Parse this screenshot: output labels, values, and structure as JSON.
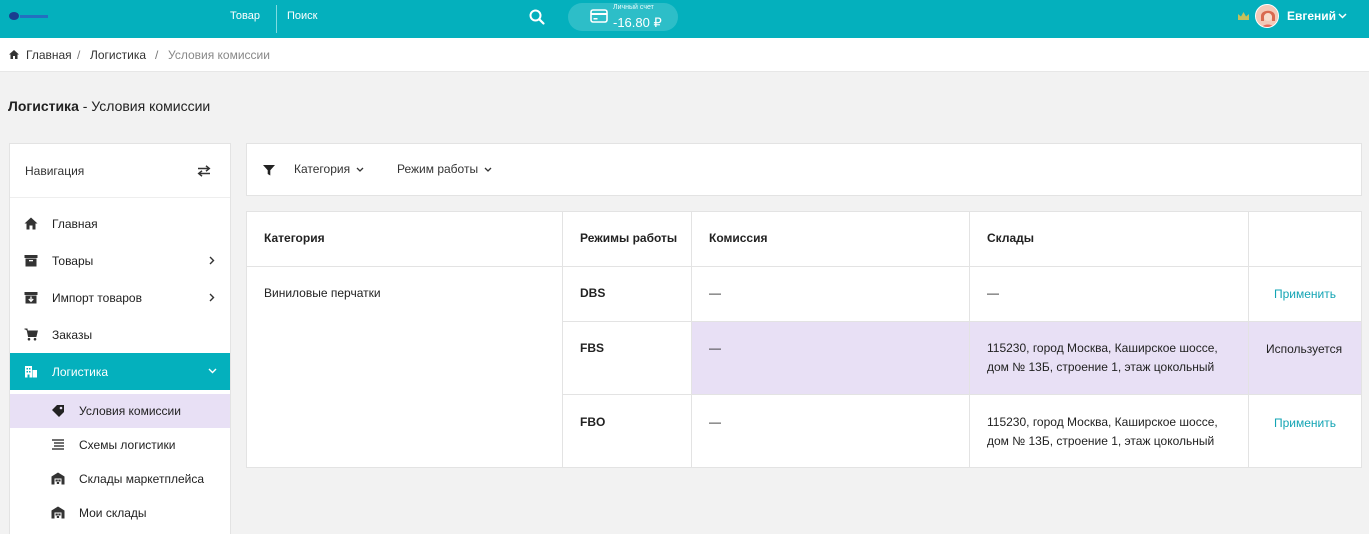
{
  "topbar": {
    "nav_tovar": "Товар",
    "nav_search": "Поиск",
    "account_label": "Личный счет",
    "account_value": "-16.80 ₽",
    "user_name": "Евгений"
  },
  "breadcrumb": {
    "home": "Главная",
    "logistics": "Логистика",
    "current": "Условия комиссии",
    "separator": "/"
  },
  "page_title": {
    "section": "Логистика",
    "rest": " - Условия комиссии"
  },
  "sidebar": {
    "title": "Навигация",
    "items": [
      {
        "label": "Главная",
        "icon": "home-icon"
      },
      {
        "label": "Товары",
        "icon": "box-icon"
      },
      {
        "label": "Импорт товаров",
        "icon": "import-icon"
      },
      {
        "label": "Заказы",
        "icon": "cart-icon"
      },
      {
        "label": "Логистика",
        "icon": "building-icon"
      }
    ],
    "subitems": [
      {
        "label": "Условия комиссии",
        "icon": "tag-icon"
      },
      {
        "label": "Схемы логистики",
        "icon": "list-icon"
      },
      {
        "label": "Склады маркетплейса",
        "icon": "warehouse-icon"
      },
      {
        "label": "Мои склады",
        "icon": "warehouse-icon"
      }
    ]
  },
  "filters": {
    "category": "Категория",
    "mode": "Режим работы"
  },
  "table": {
    "headers": [
      "Категория",
      "Режимы работы",
      "Комиссия",
      "Склады",
      ""
    ],
    "category": "Виниловые перчатки",
    "rows": [
      {
        "mode": "DBS",
        "commission": "—",
        "warehouse_line1": "—",
        "warehouse_line2": "",
        "action": "Применить"
      },
      {
        "mode": "FBS",
        "commission": "—",
        "warehouse_line1": "115230, город Москва, Каширское шоссе,",
        "warehouse_line2": "дом № 13Б, строение 1, этаж цокольный",
        "action": "Используется"
      },
      {
        "mode": "FBO",
        "commission": "—",
        "warehouse_line1": "115230, город Москва, Каширское шоссе,",
        "warehouse_line2": "дом № 13Б, строение 1, этаж цокольный",
        "action": "Применить"
      }
    ]
  },
  "colors": {
    "accent": "#04b0bd",
    "highlight": "#e8e0f5",
    "link": "#13a4b4"
  }
}
